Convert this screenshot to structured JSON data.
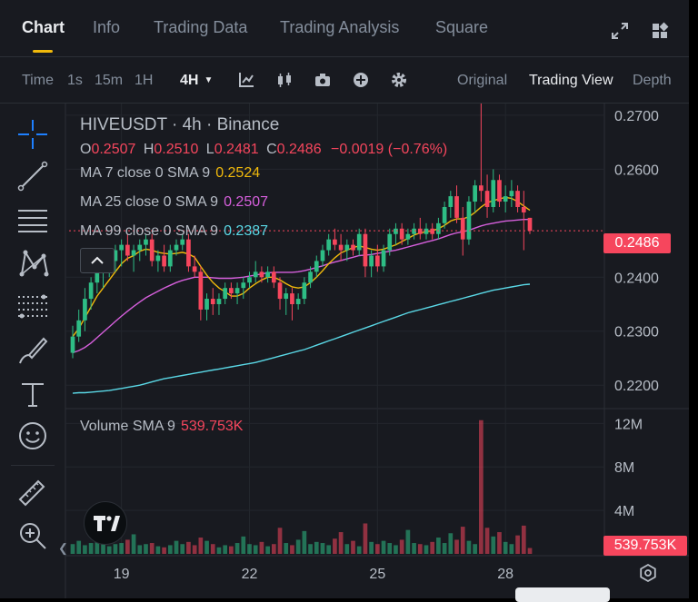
{
  "tabs": [
    {
      "label": "Chart",
      "active": true
    },
    {
      "label": "Info",
      "active": false
    },
    {
      "label": "Trading Data",
      "active": false
    },
    {
      "label": "Trading Analysis",
      "active": false
    },
    {
      "label": "Square",
      "active": false
    }
  ],
  "header_icons": [
    "expand-icon",
    "layout-grid-icon"
  ],
  "toolbar": {
    "time_label": "Time",
    "intervals": [
      "1s",
      "15m",
      "1H"
    ],
    "selected_interval": "4H",
    "icons": [
      "indicator-icon",
      "candle-type-icon",
      "camera-icon",
      "add-icon",
      "gear-icon"
    ],
    "views": [
      "Original",
      "Trading View",
      "Depth"
    ],
    "active_view": "Trading View"
  },
  "left_tools": [
    "crosshair-icon",
    "trendline-icon",
    "horizontal-lines-icon",
    "pattern-icon",
    "fib-levels-icon",
    "brush-icon",
    "text-icon",
    "emoji-icon",
    "ruler-icon",
    "zoom-icon"
  ],
  "legend": {
    "symbol": "HIVEUSDT · 4h · Binance",
    "o_label": "O",
    "o": "0.2507",
    "h_label": "H",
    "h": "0.2510",
    "l_label": "L",
    "l": "0.2481",
    "c_label": "C",
    "c": "0.2486",
    "change": "−0.0019 (−0.76%)",
    "ma": [
      {
        "label": "MA 7 close 0 SMA 9",
        "value": "0.2524",
        "color": "#f0b90b"
      },
      {
        "label": "MA 25 close 0 SMA 9",
        "value": "0.2507",
        "color": "#d65fdc"
      },
      {
        "label": "MA 99 close 0 SMA 9",
        "value": "0.2387",
        "color": "#5ad8e6"
      }
    ]
  },
  "volume_legend": {
    "label": "Volume SMA 9",
    "value": "539.753K"
  },
  "current_price": "0.2486",
  "current_volume": "539.753K",
  "colors": {
    "up": "#2ebd85",
    "down": "#f6465d",
    "ma7": "#f0b90b",
    "ma25": "#d65fdc",
    "ma99": "#5ad8e6"
  },
  "chart_data": {
    "type": "candlestick",
    "price_axis": {
      "ticks": [
        "0.2700",
        "0.2600",
        "0.2400",
        "0.2300",
        "0.2200"
      ],
      "range": [
        0.2165,
        0.2715
      ]
    },
    "volume_axis": {
      "ticks": [
        "12M",
        "8M",
        "4M"
      ],
      "range": [
        0,
        13.2
      ]
    },
    "x_ticks": [
      "19",
      "22",
      "25",
      "28"
    ],
    "candles": [
      [
        0.226,
        0.231,
        0.225,
        0.229
      ],
      [
        0.229,
        0.234,
        0.228,
        0.232
      ],
      [
        0.232,
        0.238,
        0.23,
        0.236
      ],
      [
        0.236,
        0.24,
        0.234,
        0.239
      ],
      [
        0.239,
        0.242,
        0.237,
        0.241
      ],
      [
        0.241,
        0.243,
        0.238,
        0.242
      ],
      [
        0.242,
        0.245,
        0.24,
        0.243
      ],
      [
        0.243,
        0.246,
        0.241,
        0.245
      ],
      [
        0.245,
        0.247,
        0.242,
        0.246
      ],
      [
        0.246,
        0.248,
        0.243,
        0.244
      ],
      [
        0.244,
        0.246,
        0.241,
        0.245
      ],
      [
        0.245,
        0.247,
        0.243,
        0.246
      ],
      [
        0.246,
        0.248,
        0.244,
        0.247
      ],
      [
        0.247,
        0.248,
        0.242,
        0.243
      ],
      [
        0.243,
        0.245,
        0.241,
        0.244
      ],
      [
        0.244,
        0.246,
        0.241,
        0.242
      ],
      [
        0.242,
        0.246,
        0.241,
        0.245
      ],
      [
        0.245,
        0.247,
        0.244,
        0.246
      ],
      [
        0.246,
        0.248,
        0.245,
        0.247
      ],
      [
        0.247,
        0.248,
        0.241,
        0.242
      ],
      [
        0.242,
        0.244,
        0.24,
        0.241
      ],
      [
        0.241,
        0.242,
        0.232,
        0.234
      ],
      [
        0.234,
        0.237,
        0.232,
        0.236
      ],
      [
        0.236,
        0.238,
        0.233,
        0.235
      ],
      [
        0.235,
        0.237,
        0.233,
        0.236
      ],
      [
        0.236,
        0.239,
        0.235,
        0.238
      ],
      [
        0.238,
        0.239,
        0.236,
        0.237
      ],
      [
        0.237,
        0.239,
        0.235,
        0.238
      ],
      [
        0.238,
        0.24,
        0.236,
        0.239
      ],
      [
        0.239,
        0.241,
        0.238,
        0.24
      ],
      [
        0.24,
        0.243,
        0.239,
        0.241
      ],
      [
        0.241,
        0.242,
        0.239,
        0.24
      ],
      [
        0.24,
        0.242,
        0.239,
        0.241
      ],
      [
        0.241,
        0.242,
        0.238,
        0.239
      ],
      [
        0.239,
        0.24,
        0.234,
        0.236
      ],
      [
        0.236,
        0.238,
        0.233,
        0.237
      ],
      [
        0.237,
        0.238,
        0.232,
        0.235
      ],
      [
        0.235,
        0.237,
        0.234,
        0.236
      ],
      [
        0.236,
        0.24,
        0.235,
        0.239
      ],
      [
        0.239,
        0.242,
        0.238,
        0.241
      ],
      [
        0.241,
        0.244,
        0.24,
        0.243
      ],
      [
        0.243,
        0.246,
        0.242,
        0.245
      ],
      [
        0.245,
        0.248,
        0.244,
        0.247
      ],
      [
        0.247,
        0.249,
        0.245,
        0.246
      ],
      [
        0.246,
        0.248,
        0.243,
        0.245
      ],
      [
        0.245,
        0.247,
        0.243,
        0.246
      ],
      [
        0.246,
        0.247,
        0.244,
        0.245
      ],
      [
        0.245,
        0.249,
        0.244,
        0.248
      ],
      [
        0.248,
        0.249,
        0.24,
        0.242
      ],
      [
        0.242,
        0.245,
        0.24,
        0.244
      ],
      [
        0.244,
        0.246,
        0.241,
        0.242
      ],
      [
        0.242,
        0.246,
        0.241,
        0.245
      ],
      [
        0.245,
        0.249,
        0.244,
        0.248
      ],
      [
        0.248,
        0.25,
        0.246,
        0.249
      ],
      [
        0.249,
        0.25,
        0.246,
        0.247
      ],
      [
        0.247,
        0.249,
        0.246,
        0.248
      ],
      [
        0.248,
        0.25,
        0.247,
        0.249
      ],
      [
        0.249,
        0.251,
        0.247,
        0.248
      ],
      [
        0.248,
        0.25,
        0.247,
        0.249
      ],
      [
        0.249,
        0.25,
        0.247,
        0.248
      ],
      [
        0.248,
        0.251,
        0.247,
        0.25
      ],
      [
        0.25,
        0.254,
        0.249,
        0.253
      ],
      [
        0.253,
        0.256,
        0.251,
        0.255
      ],
      [
        0.255,
        0.257,
        0.25,
        0.251
      ],
      [
        0.251,
        0.253,
        0.244,
        0.247
      ],
      [
        0.247,
        0.255,
        0.246,
        0.254
      ],
      [
        0.254,
        0.258,
        0.252,
        0.257
      ],
      [
        0.257,
        0.273,
        0.254,
        0.256
      ],
      [
        0.256,
        0.259,
        0.251,
        0.253
      ],
      [
        0.253,
        0.26,
        0.252,
        0.258
      ],
      [
        0.258,
        0.259,
        0.253,
        0.254
      ],
      [
        0.254,
        0.257,
        0.252,
        0.255
      ],
      [
        0.255,
        0.258,
        0.253,
        0.256
      ],
      [
        0.256,
        0.257,
        0.252,
        0.253
      ],
      [
        0.253,
        0.256,
        0.245,
        0.252
      ],
      [
        0.251,
        0.251,
        0.248,
        0.2486
      ]
    ],
    "volume_millions": [
      0.9,
      1.2,
      0.8,
      1.0,
      1.4,
      1.1,
      0.7,
      0.9,
      1.0,
      1.3,
      1.8,
      0.8,
      0.9,
      1.0,
      0.7,
      0.6,
      0.8,
      1.2,
      0.9,
      1.1,
      0.8,
      1.5,
      1.2,
      0.9,
      0.6,
      0.8,
      0.7,
      1.0,
      1.6,
      0.9,
      0.8,
      1.1,
      0.7,
      0.9,
      2.4,
      1.0,
      0.8,
      1.3,
      2.1,
      0.9,
      1.1,
      1.0,
      0.8,
      1.4,
      2.0,
      0.9,
      1.2,
      0.7,
      2.8,
      1.1,
      0.9,
      1.2,
      1.0,
      0.8,
      1.3,
      2.2,
      1.0,
      0.9,
      0.8,
      1.1,
      1.5,
      1.0,
      1.9,
      1.3,
      2.5,
      1.2,
      0.9,
      12.3,
      2.4,
      1.6,
      2.0,
      1.1,
      0.9,
      1.7,
      2.6,
      0.54
    ],
    "ma7": [
      0.229,
      0.2305,
      0.2325,
      0.2345,
      0.2365,
      0.238,
      0.2395,
      0.241,
      0.2425,
      0.2435,
      0.244,
      0.2448,
      0.2452,
      0.245,
      0.2446,
      0.2444,
      0.2443,
      0.2444,
      0.2446,
      0.2443,
      0.2437,
      0.242,
      0.2404,
      0.239,
      0.238,
      0.2373,
      0.2365,
      0.2365,
      0.237,
      0.238,
      0.2388,
      0.2395,
      0.24,
      0.24,
      0.2395,
      0.2388,
      0.2382,
      0.238,
      0.2382,
      0.239,
      0.24,
      0.2412,
      0.2425,
      0.2436,
      0.2445,
      0.245,
      0.2455,
      0.2458,
      0.2455,
      0.2452,
      0.245,
      0.2452,
      0.2456,
      0.246,
      0.2466,
      0.2472,
      0.2478,
      0.2482,
      0.2484,
      0.2486,
      0.249,
      0.2496,
      0.2504,
      0.2508,
      0.2508,
      0.2512,
      0.252,
      0.253,
      0.2538,
      0.2542,
      0.2545,
      0.2548,
      0.2546,
      0.254,
      0.2532,
      0.2524
    ],
    "ma25": [
      0.226,
      0.2264,
      0.227,
      0.2278,
      0.2288,
      0.2298,
      0.2308,
      0.2318,
      0.2328,
      0.2337,
      0.2346,
      0.2354,
      0.2362,
      0.2368,
      0.2374,
      0.238,
      0.2385,
      0.239,
      0.2394,
      0.2397,
      0.24,
      0.24,
      0.24,
      0.2399,
      0.2398,
      0.2398,
      0.2398,
      0.2399,
      0.24,
      0.2402,
      0.2404,
      0.2406,
      0.2408,
      0.2409,
      0.2409,
      0.2409,
      0.2409,
      0.241,
      0.2412,
      0.2415,
      0.2418,
      0.2421,
      0.2425,
      0.2428,
      0.2431,
      0.2434,
      0.2437,
      0.244,
      0.2441,
      0.2442,
      0.2444,
      0.2446,
      0.2448,
      0.245,
      0.2453,
      0.2456,
      0.2459,
      0.2462,
      0.2465,
      0.2468,
      0.2471,
      0.2475,
      0.2479,
      0.2482,
      0.2484,
      0.2487,
      0.2491,
      0.2495,
      0.2498,
      0.25,
      0.2502,
      0.2504,
      0.2505,
      0.2506,
      0.2507,
      0.2507
    ],
    "ma99": [
      0.2185,
      0.2186,
      0.2186,
      0.2187,
      0.2188,
      0.2189,
      0.219,
      0.2192,
      0.2194,
      0.2196,
      0.2198,
      0.22,
      0.2203,
      0.2206,
      0.2209,
      0.2212,
      0.2214,
      0.2216,
      0.2218,
      0.222,
      0.2222,
      0.2224,
      0.2226,
      0.2228,
      0.223,
      0.2232,
      0.2234,
      0.2236,
      0.2238,
      0.224,
      0.2242,
      0.2245,
      0.2248,
      0.2251,
      0.2254,
      0.2257,
      0.226,
      0.2263,
      0.2266,
      0.227,
      0.2274,
      0.2278,
      0.2282,
      0.2286,
      0.229,
      0.2294,
      0.2298,
      0.2302,
      0.2306,
      0.231,
      0.2314,
      0.2318,
      0.2322,
      0.2326,
      0.233,
      0.2334,
      0.2337,
      0.234,
      0.2343,
      0.2346,
      0.2349,
      0.2352,
      0.2355,
      0.2358,
      0.2361,
      0.2364,
      0.2367,
      0.237,
      0.2373,
      0.2376,
      0.2378,
      0.238,
      0.2382,
      0.2384,
      0.2386,
      0.2387
    ]
  }
}
